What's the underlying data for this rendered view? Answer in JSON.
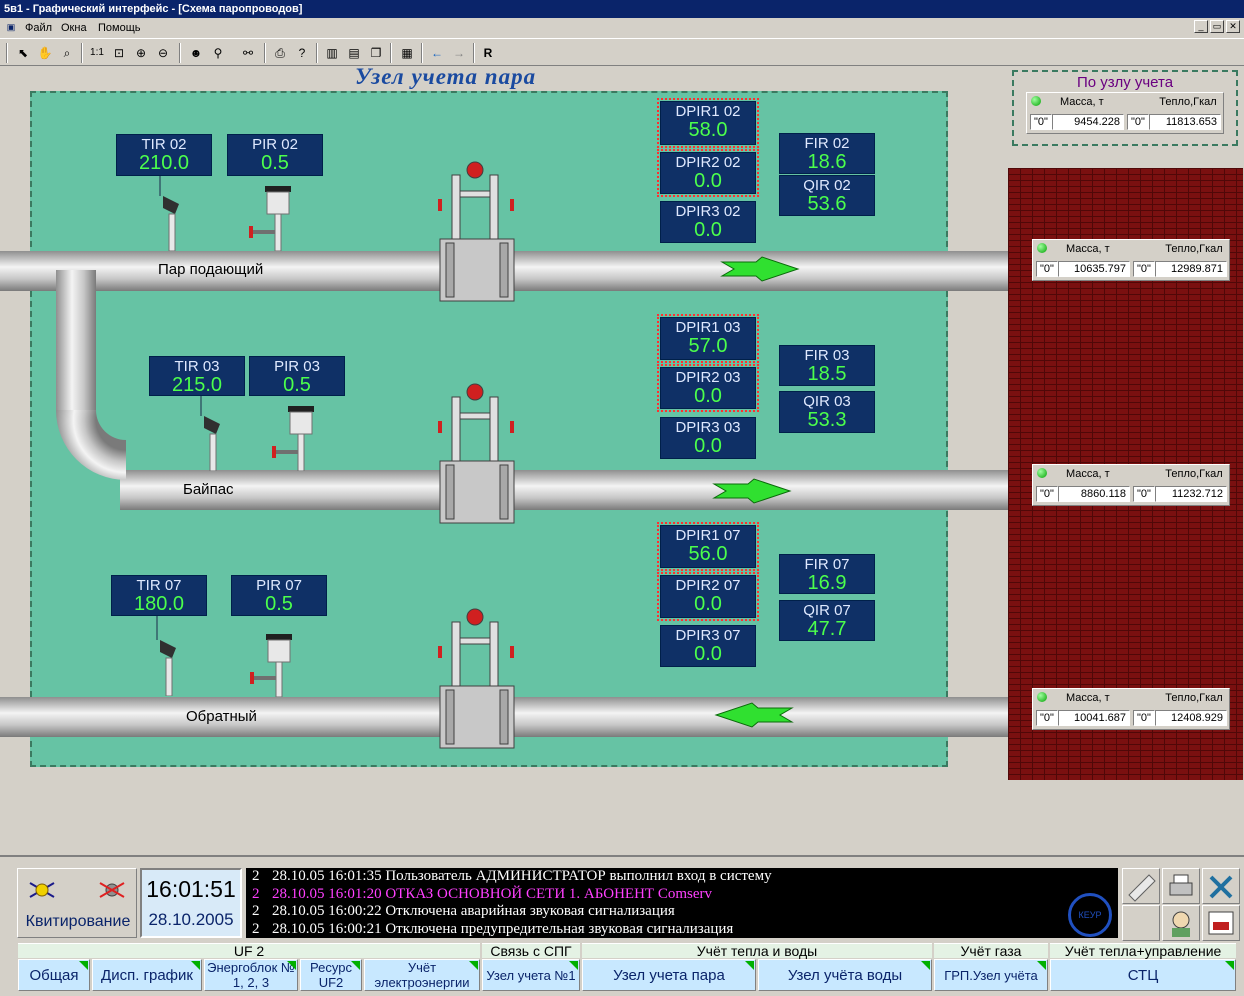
{
  "window": {
    "title": "5в1 - Графический интерфейс - [Схема паропроводов]",
    "menu": [
      "Файл",
      "Окна",
      "Помощь"
    ],
    "controls": [
      "_",
      "▭",
      "✕"
    ]
  },
  "toolbar": {
    "buttons": [
      "pointer-icon",
      "hand-icon",
      "zoom-icon",
      "actual-size-icon",
      "zoom-fit-icon",
      "zoom-in-icon",
      "zoom-out-icon",
      "find-object-icon",
      "binoculars-icon",
      "print-icon",
      "help-icon",
      "layout-vertical-icon",
      "layout-horizontal-icon",
      "cascade-icon",
      "window-list-icon",
      "back-icon",
      "forward-icon",
      "refresh-icon"
    ],
    "actual_size_label": "1:1",
    "refresh_label": "R"
  },
  "schema": {
    "title": "Узел учета пара",
    "pipes": {
      "supply": "Пар подающий",
      "bypass": "Байпас",
      "return": "Обратный"
    },
    "supply": {
      "tir": {
        "name": "TIR 02",
        "value": "210.0"
      },
      "pir": {
        "name": "PIR 02",
        "value": "0.5"
      },
      "dpir1": {
        "name": "DPIR1 02",
        "value": "58.0"
      },
      "dpir2": {
        "name": "DPIR2 02",
        "value": "0.0"
      },
      "dpir3": {
        "name": "DPIR3 02",
        "value": "0.0"
      },
      "fir": {
        "name": "FIR 02",
        "value": "18.6"
      },
      "qir": {
        "name": "QIR 02",
        "value": "53.6"
      }
    },
    "bypass": {
      "tir": {
        "name": "TIR 03",
        "value": "215.0"
      },
      "pir": {
        "name": "PIR 03",
        "value": "0.5"
      },
      "dpir1": {
        "name": "DPIR1 03",
        "value": "57.0"
      },
      "dpir2": {
        "name": "DPIR2 03",
        "value": "0.0"
      },
      "dpir3": {
        "name": "DPIR3 03",
        "value": "0.0"
      },
      "fir": {
        "name": "FIR 03",
        "value": "18.5"
      },
      "qir": {
        "name": "QIR 03",
        "value": "53.3"
      }
    },
    "return": {
      "tir": {
        "name": "TIR 07",
        "value": "180.0"
      },
      "pir": {
        "name": "PIR 07",
        "value": "0.5"
      },
      "dpir1": {
        "name": "DPIR1 07",
        "value": "56.0"
      },
      "dpir2": {
        "name": "DPIR2 07",
        "value": "0.0"
      },
      "dpir3": {
        "name": "DPIR3 07",
        "value": "0.0"
      },
      "fir": {
        "name": "FIR 07",
        "value": "16.9"
      },
      "qir": {
        "name": "QIR 07",
        "value": "47.7"
      }
    }
  },
  "counters": {
    "mass_label": "Масса, т",
    "heat_label": "Тепло,Гкал",
    "quality": "\"0\"",
    "summary_title": "По узлу учета",
    "summary": {
      "mass": "9454.228",
      "heat": "11813.653"
    },
    "supply": {
      "mass": "10635.797",
      "heat": "12989.871"
    },
    "bypass": {
      "mass": "8860.118",
      "heat": "11232.712"
    },
    "return": {
      "mass": "10041.687",
      "heat": "12408.929"
    }
  },
  "bottom": {
    "ack_label": "Квитирование",
    "time": "16:01:51",
    "date": "28.10.2005",
    "log": [
      {
        "level": "2",
        "text": "28.10.05 16:01:35 Пользователь АДМИНИСТРАТОР выполнил вход в систему",
        "alert": false
      },
      {
        "level": "2",
        "text": "28.10.05 16:01:20 ОТКАЗ ОСНОВНОЙ СЕТИ 1. АБОНЕНТ Comserv",
        "alert": true
      },
      {
        "level": "2",
        "text": "28.10.05 16:00:22 Отключена аварийная звуковая сигнализация",
        "alert": false
      },
      {
        "level": "2",
        "text": "28.10.05 16:00:21 Отключена предупредительная звуковая сигнализация",
        "alert": false
      }
    ],
    "logo_text": "КЕУР",
    "groups": [
      "UF 2",
      "Связь с СПГ",
      "Учёт тепла и воды",
      "Учёт газа",
      "Учёт тепла+управление"
    ],
    "nav": [
      "Общая",
      "Дисп. график",
      "Энергоблок № 1, 2, 3",
      "Ресурс UF2",
      "Учёт электроэнергии",
      "Узел учета №1",
      "Узел учета пара",
      "Узел учёта воды",
      "ГРП.Узел учёта",
      "СТЦ"
    ]
  },
  "colors": {
    "alarm": "#ff3030",
    "value": "#4cff4c",
    "tag_bg": "#0f3066",
    "area": "#66c3a4",
    "log_alert": "#ff40ff"
  }
}
